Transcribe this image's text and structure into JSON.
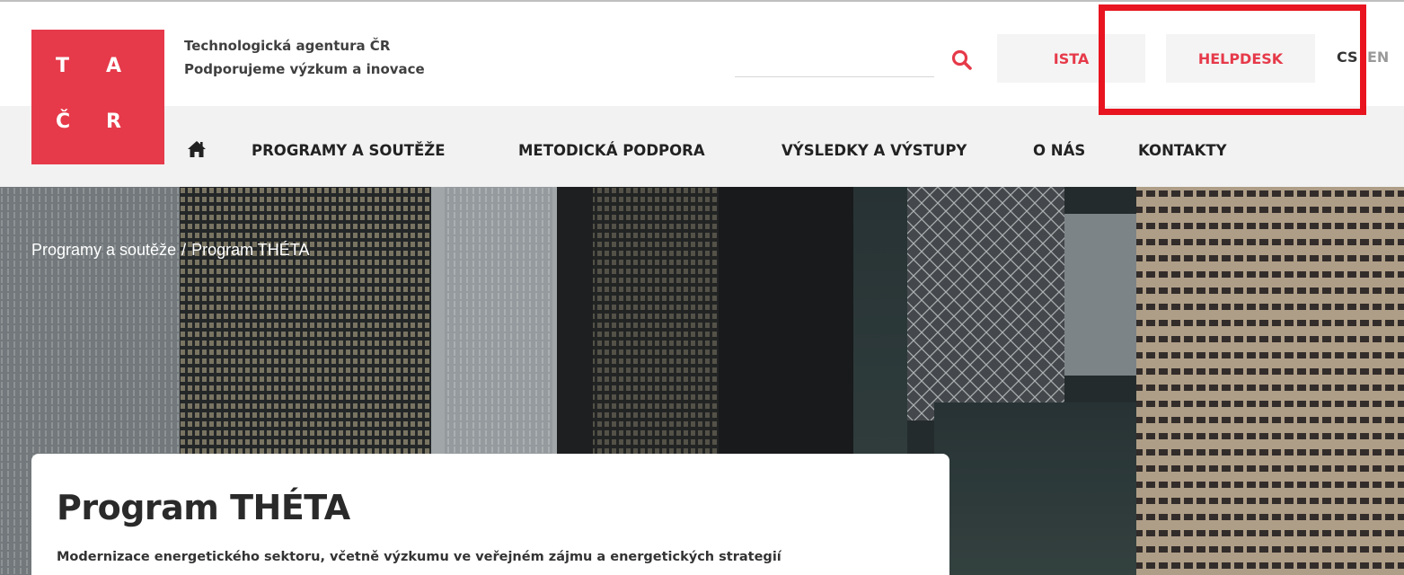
{
  "logo": {
    "letters": [
      "T",
      "A",
      "Č",
      "R"
    ]
  },
  "agency": {
    "name": "Technologická agentura ČR",
    "tagline": "Podporujeme výzkum a inovace"
  },
  "search": {
    "placeholder": "",
    "icon": "search-icon"
  },
  "header_buttons": {
    "ista": "ISTA",
    "helpdesk": "HELPDESK"
  },
  "languages": {
    "cs": "CS",
    "en": "EN"
  },
  "nav": {
    "home_icon": "home-icon",
    "items": [
      "PROGRAMY A SOUTĚŽE",
      "METODICKÁ PODPORA",
      "VÝSLEDKY A VÝSTUPY",
      "O NÁS",
      "KONTAKTY"
    ]
  },
  "breadcrumb": {
    "items": [
      "Programy a soutěže",
      "Program THÉTA"
    ],
    "separator": "/"
  },
  "hero": {
    "title": "Program THÉTA",
    "subtitle": "Modernizace energetického sektoru, včetně výzkumu ve veřejném zájmu a energetických strategií"
  },
  "colors": {
    "brand": "#e63a4a",
    "highlight": "#e8141f",
    "text_dark": "#222222"
  }
}
